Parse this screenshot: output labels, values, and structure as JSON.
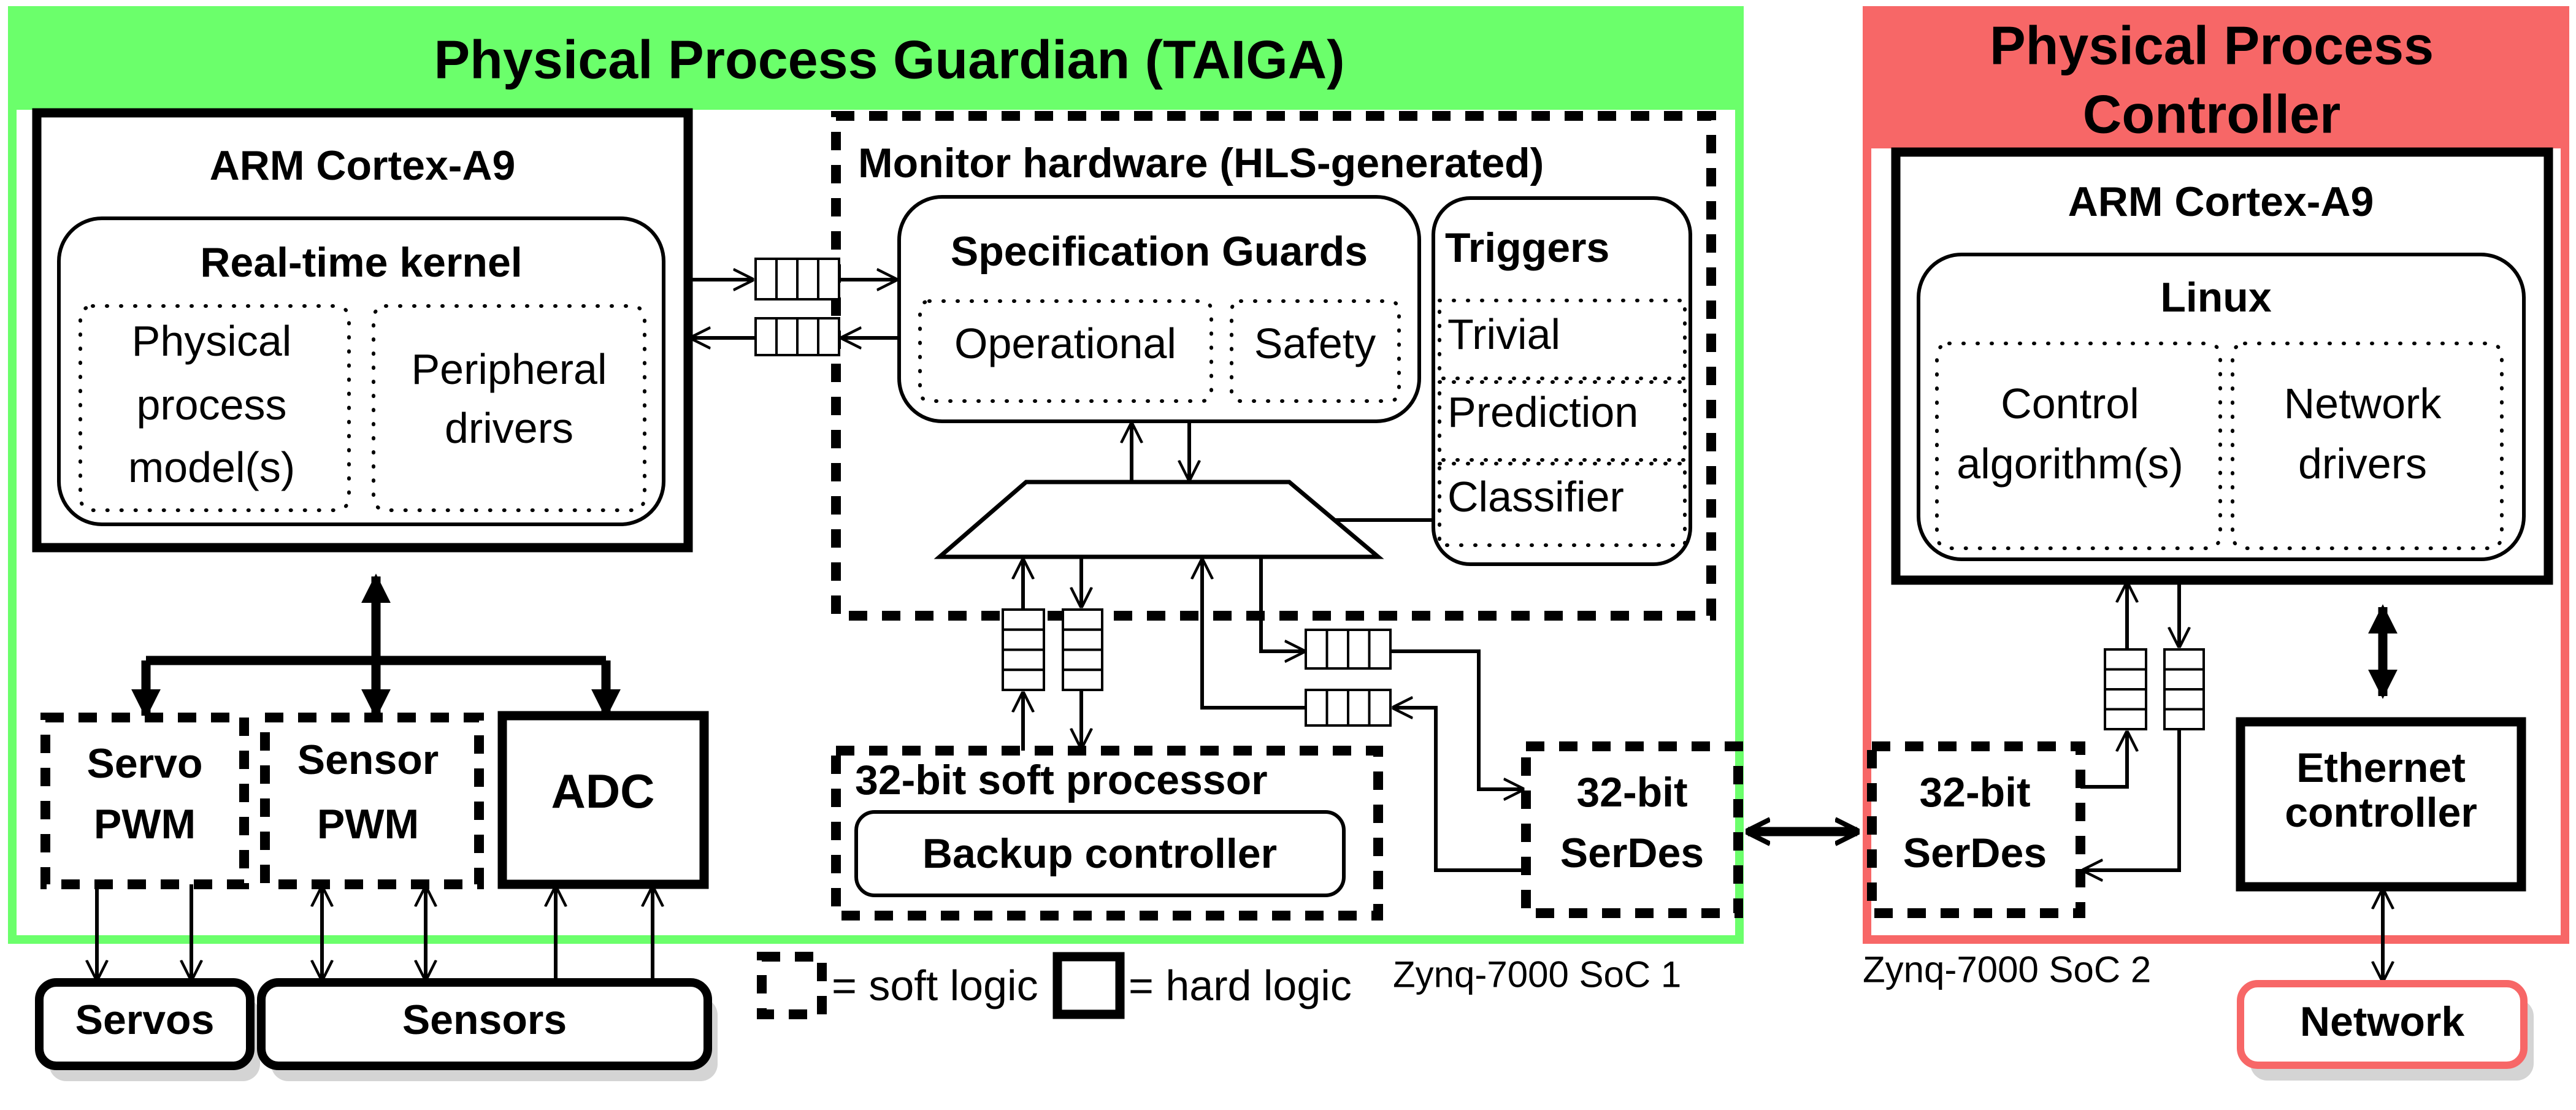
{
  "guardian": {
    "title": "Physical Process Guardian (TAIGA)",
    "color": "#6bff6b"
  },
  "controller": {
    "title_line1": "Physical Process",
    "title_line2": "Controller",
    "color": "#f76767"
  },
  "arm_left": {
    "title": "ARM Cortex-A9",
    "kernel": "Real-time kernel",
    "model_lines": [
      "Physical",
      "process",
      "model(s)"
    ],
    "drivers_lines": [
      "Peripheral",
      "drivers"
    ]
  },
  "monitor": {
    "title": "Monitor hardware (HLS-generated)",
    "spec_guards": "Specification Guards",
    "operational": "Operational",
    "safety": "Safety",
    "triggers": "Triggers",
    "trigger_items": [
      "Trivial",
      "Prediction",
      "Classifier"
    ]
  },
  "soft_processor": {
    "title": "32-bit soft processor",
    "backup": "Backup controller"
  },
  "peripherals": {
    "servo_pwm": [
      "Servo",
      "PWM"
    ],
    "sensor_pwm": [
      "Sensor",
      "PWM"
    ],
    "adc": "ADC"
  },
  "external": {
    "servos": "Servos",
    "sensors": "Sensors",
    "network": "Network"
  },
  "serdes": {
    "left": [
      "32-bit",
      "SerDes"
    ],
    "right": [
      "32-bit",
      "SerDes"
    ]
  },
  "legend": {
    "soft": "= soft logic",
    "hard": "= hard logic"
  },
  "soc_labels": {
    "soc1": "Zynq-7000 SoC 1",
    "soc2": "Zynq-7000 SoC 2"
  },
  "arm_right": {
    "title": "ARM Cortex-A9",
    "os": "Linux",
    "control_lines": [
      "Control",
      "algorithm(s)"
    ],
    "network_lines": [
      "Network",
      "drivers"
    ]
  },
  "ethernet": [
    "Ethernet",
    "controller"
  ]
}
